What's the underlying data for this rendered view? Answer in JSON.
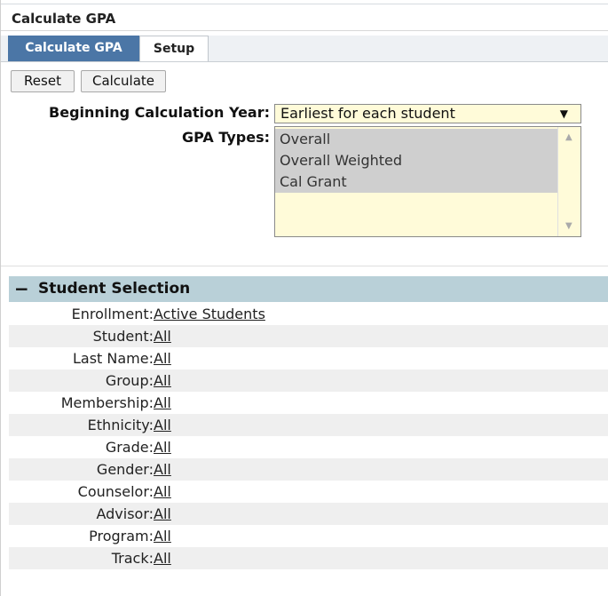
{
  "page": {
    "title": "Calculate GPA"
  },
  "tabs": [
    {
      "label": "Calculate GPA",
      "active": true
    },
    {
      "label": "Setup",
      "active": false
    }
  ],
  "toolbar": {
    "reset_label": "Reset",
    "calculate_label": "Calculate"
  },
  "form": {
    "beginning_year_label": "Beginning Calculation Year:",
    "beginning_year_value": "Earliest for each student",
    "gpa_types_label": "GPA Types:",
    "gpa_types_options": [
      "Overall",
      "Overall Weighted",
      "Cal Grant"
    ]
  },
  "student_selection": {
    "toggle": "−",
    "title": "Student Selection",
    "rows": [
      {
        "label": "Enrollment:",
        "value": "Active Students"
      },
      {
        "label": "Student:",
        "value": "All"
      },
      {
        "label": "Last Name:",
        "value": "All"
      },
      {
        "label": "Group:",
        "value": "All"
      },
      {
        "label": "Membership:",
        "value": "All"
      },
      {
        "label": "Ethnicity:",
        "value": "All"
      },
      {
        "label": "Grade:",
        "value": "All"
      },
      {
        "label": "Gender:",
        "value": "All"
      },
      {
        "label": "Counselor:",
        "value": "All"
      },
      {
        "label": "Advisor:",
        "value": "All"
      },
      {
        "label": "Program:",
        "value": "All"
      },
      {
        "label": "Track:",
        "value": "All"
      }
    ]
  },
  "colors": {
    "tab_active": "#4b76a6",
    "section_header": "#b9d0d8",
    "select_bg": "#fffbd9",
    "row_alt": "#efefef"
  }
}
